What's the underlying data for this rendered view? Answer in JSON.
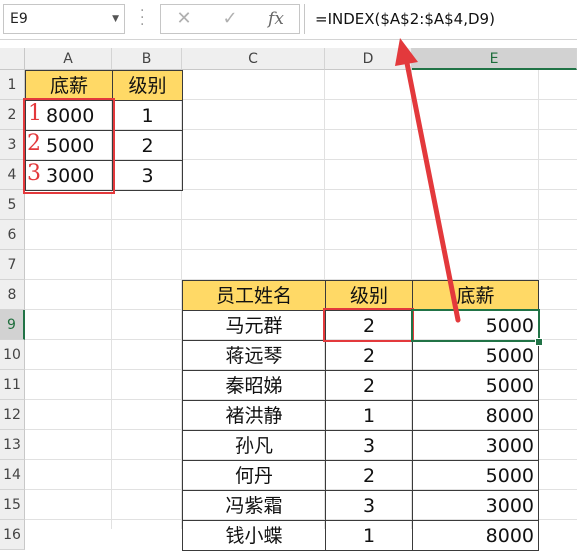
{
  "name_box": "E9",
  "formula_bar": {
    "cancel_symbol": "✕",
    "enter_symbol": "✓",
    "fx_label": "fx",
    "formula": "=INDEX($A$2:$A$4,D9)"
  },
  "columns": [
    "A",
    "B",
    "C",
    "D",
    "E"
  ],
  "rows": [
    "1",
    "2",
    "3",
    "4",
    "5",
    "6",
    "7",
    "8",
    "9",
    "10",
    "11",
    "12",
    "13",
    "14",
    "15",
    "16"
  ],
  "lookup_table": {
    "headers": [
      "底薪",
      "级别"
    ],
    "rows": [
      {
        "mark": "1",
        "salary": "8000",
        "level": "1"
      },
      {
        "mark": "2",
        "salary": "5000",
        "level": "2"
      },
      {
        "mark": "3",
        "salary": "3000",
        "level": "3"
      }
    ]
  },
  "employee_table": {
    "headers": [
      "员工姓名",
      "级别",
      "底薪"
    ],
    "rows": [
      {
        "name": "马元群",
        "level": "2",
        "salary": "5000"
      },
      {
        "name": "蒋远琴",
        "level": "2",
        "salary": "5000"
      },
      {
        "name": "秦昭娣",
        "level": "2",
        "salary": "5000"
      },
      {
        "name": "褚洪静",
        "level": "1",
        "salary": "8000"
      },
      {
        "name": "孙凡",
        "level": "3",
        "salary": "3000"
      },
      {
        "name": "何丹",
        "level": "2",
        "salary": "5000"
      },
      {
        "name": "冯紫霜",
        "level": "3",
        "salary": "3000"
      },
      {
        "name": "钱小蝶",
        "level": "1",
        "salary": "8000"
      }
    ]
  },
  "colors": {
    "header_fill": "#ffd966",
    "annotation_red": "#e3393c",
    "selection_green": "#217346"
  }
}
